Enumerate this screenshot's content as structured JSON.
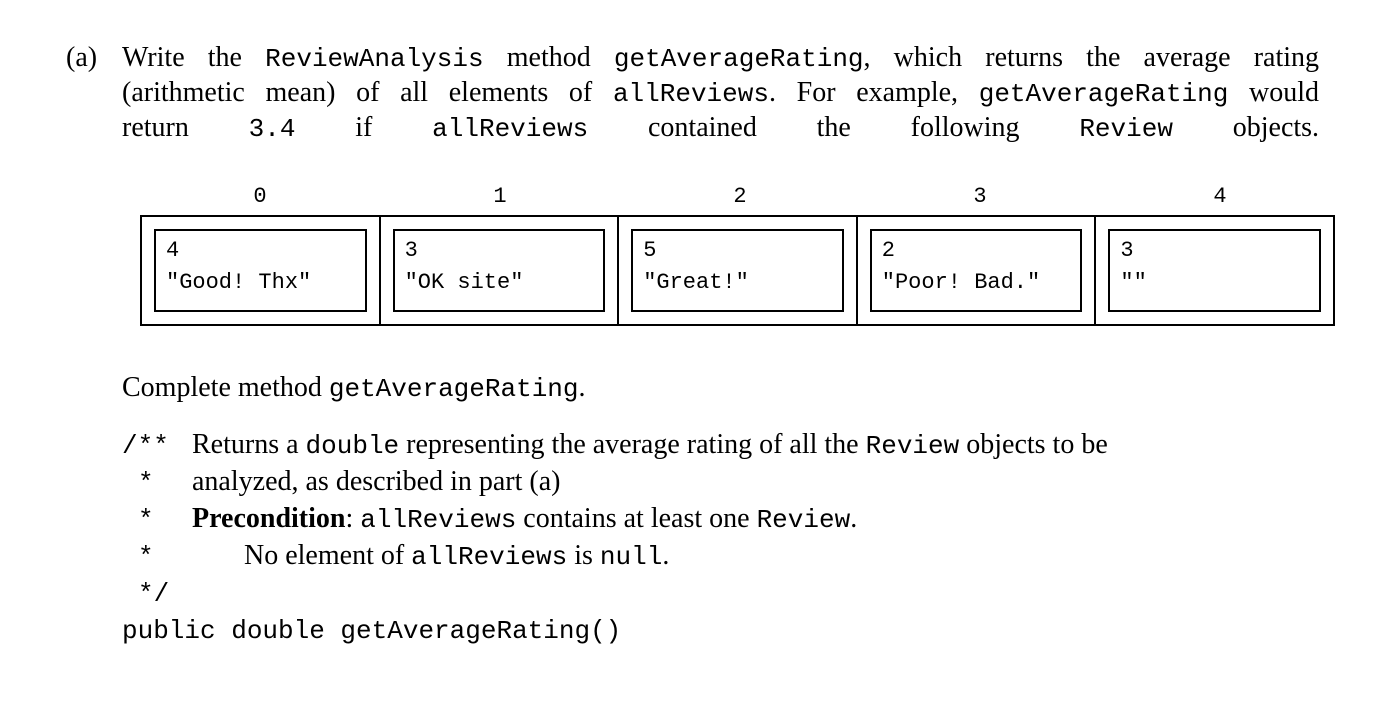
{
  "part": {
    "label": "(a)",
    "line1": {
      "t1": "Write the",
      "c1": "ReviewAnalysis",
      "t2": "method",
      "c2": "getAverageRating",
      "t3": ", which returns the average rating"
    },
    "line2": {
      "t1": "(arithmetic mean) of all elements of",
      "c1": "allReviews",
      "t2": ". For example,",
      "c2": "getAverageRating",
      "t3": "would"
    },
    "line3": {
      "t1": "return",
      "c1": "3.4",
      "t2": "if",
      "c2": "allReviews",
      "t3": "contained the following",
      "c3": "Review",
      "t4": "objects."
    }
  },
  "array": {
    "indices": [
      "0",
      "1",
      "2",
      "3",
      "4"
    ],
    "reviews": [
      {
        "rating": "4",
        "comment": "\"Good! Thx\""
      },
      {
        "rating": "3",
        "comment": "\"OK site\""
      },
      {
        "rating": "5",
        "comment": "\"Great!\""
      },
      {
        "rating": "2",
        "comment": "\"Poor! Bad.\""
      },
      {
        "rating": "3",
        "comment": "\"\""
      }
    ]
  },
  "complete": {
    "t1": "Complete method",
    "c1": "getAverageRating",
    "t2": "."
  },
  "doc": {
    "open": "/**",
    "star": "*",
    "close": "*/",
    "line1": {
      "t1": "Returns a",
      "c1": "double",
      "t2": "representing the average rating of all the",
      "c2": "Review",
      "t3": "objects to be"
    },
    "line2": {
      "t1": "analyzed, as described in part (a)"
    },
    "line3": {
      "b1": "Precondition",
      "t1": ":",
      "c1": "allReviews",
      "t2": "contains at least one",
      "c2": "Review",
      "t3": "."
    },
    "line4": {
      "t1": "No element of",
      "c1": "allReviews",
      "t2": "is",
      "c2": "null",
      "t3": "."
    }
  },
  "signature": "public double getAverageRating()"
}
